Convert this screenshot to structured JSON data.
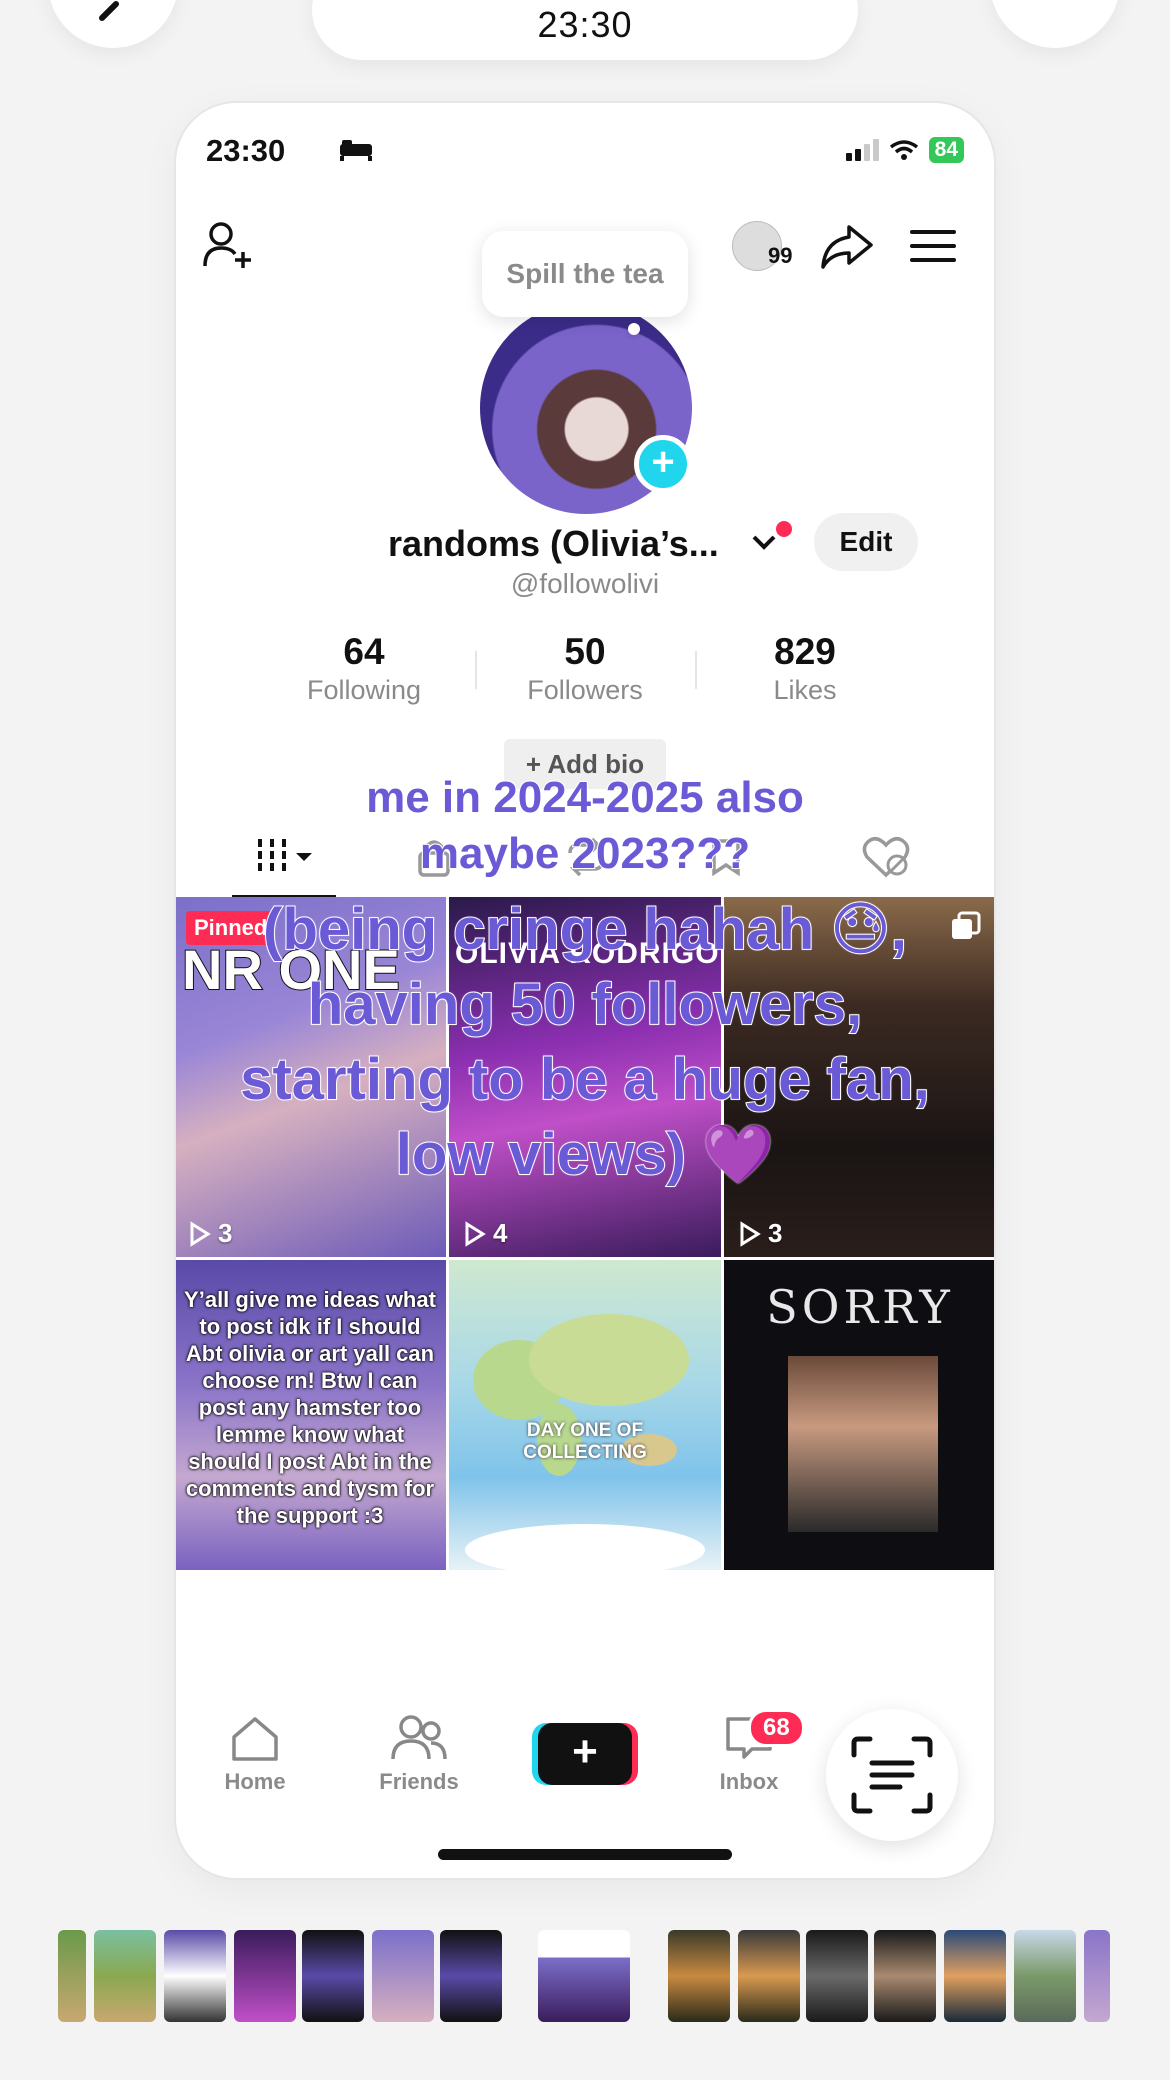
{
  "editor": {
    "time": "23:30"
  },
  "status_bar": {
    "time": "23:30",
    "battery": "84"
  },
  "profile": {
    "tooltip": "Spill the tea",
    "username": "randoms (Olivia’s...",
    "edit_label": "Edit",
    "handle": "@followolivi",
    "add_bio": "+ Add bio",
    "friends_badge": "99"
  },
  "stats": [
    {
      "value": "64",
      "label": "Following"
    },
    {
      "value": "50",
      "label": "Followers"
    },
    {
      "value": "829",
      "label": "Likes"
    }
  ],
  "videos": [
    {
      "views": "3",
      "badge": "Pinned",
      "caption": "NR ONE"
    },
    {
      "views": "4",
      "caption": "OLIVIA RODRIGO"
    },
    {
      "views": "3"
    },
    {
      "caption": "Y’all give me ideas what to post idk if I should Abt olivia or art yall can choose rn! Btw I can post any hamster too lemme know what should I post Abt in the comments and tysm for the support :3"
    },
    {
      "caption": "DAY ONE OF COLLECTING"
    },
    {
      "caption": "SORRY"
    }
  ],
  "overlay": {
    "line1": "me in 2024-2025 also",
    "line2": "maybe 2023???",
    "line3": "(being cringe hahah 😓,",
    "line4": "having 50 followers,",
    "line5": "starting to be a huge fan,",
    "line6": "low views) 💜"
  },
  "nav": {
    "home": "Home",
    "friends": "Friends",
    "inbox": "Inbox",
    "inbox_badge": "68"
  },
  "colors": {
    "accent_red": "#fe2c55",
    "accent_cyan": "#20d5ec",
    "overlay_text": "#6a5ad6"
  }
}
